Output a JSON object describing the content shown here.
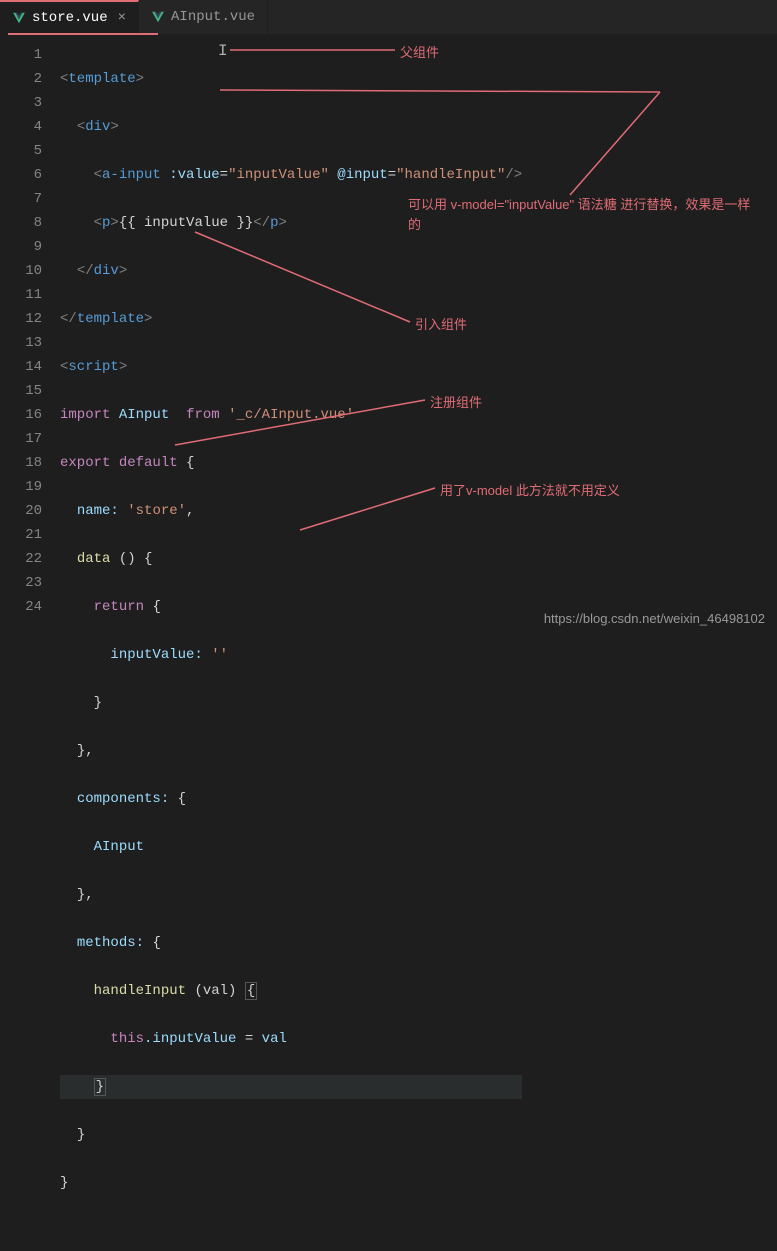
{
  "tabs": {
    "active": {
      "label": "store.vue"
    },
    "inactive": {
      "label": "AInput.vue"
    },
    "close_glyph": "×"
  },
  "lines": {
    "l1": "1",
    "l2": "2",
    "l3": "3",
    "l4": "4",
    "l5": "5",
    "l6": "6",
    "l7": "7",
    "l8": "8",
    "l9": "9",
    "l10": "10",
    "l11": "11",
    "l12": "12",
    "l13": "13",
    "l14": "14",
    "l15": "15",
    "l16": "16",
    "l17": "17",
    "l18": "18",
    "l19": "19",
    "l20": "20",
    "l21": "21",
    "l22": "22",
    "l23": "23",
    "l24": "24"
  },
  "code": {
    "template_open": "template",
    "div_open": "div",
    "a_input_tag": "a-input",
    "value_attr": ":value",
    "value_str": "\"inputValue\"",
    "input_evt": "@input",
    "handle_str": "\"handleInput\"",
    "p_tag": "p",
    "mustache": "{{ inputValue }}",
    "script_tag": "script",
    "import_kw": "import",
    "ainput_ident": "AInput",
    "from_kw": "from",
    "import_path": "'_c/AInput.vue'",
    "export_kw": "export",
    "default_kw": "default",
    "name_prop": "name:",
    "name_val": "'store'",
    "data_prop": "data",
    "return_kw": "return",
    "inputvalue_prop": "inputValue:",
    "empty_str": "''",
    "components_prop": "components:",
    "ainput_reg": "AInput",
    "methods_prop": "methods:",
    "handleinput_fn": "handleInput",
    "val_param": "(val)",
    "this_kw": "this",
    "inputvalue_assign": ".inputValue",
    "equals": "=",
    "val_ident": "val"
  },
  "annotations": {
    "parent": "父组件",
    "syntax_sugar": "可以用 v-model=\"inputValue\" 语法糖 进行替换，效果是一样的",
    "import_comp": "引入组件",
    "register_comp": "注册组件",
    "vmodel_note": "用了v-model 此方法就不用定义"
  },
  "watermark": "https://blog.csdn.net/weixin_46498102"
}
